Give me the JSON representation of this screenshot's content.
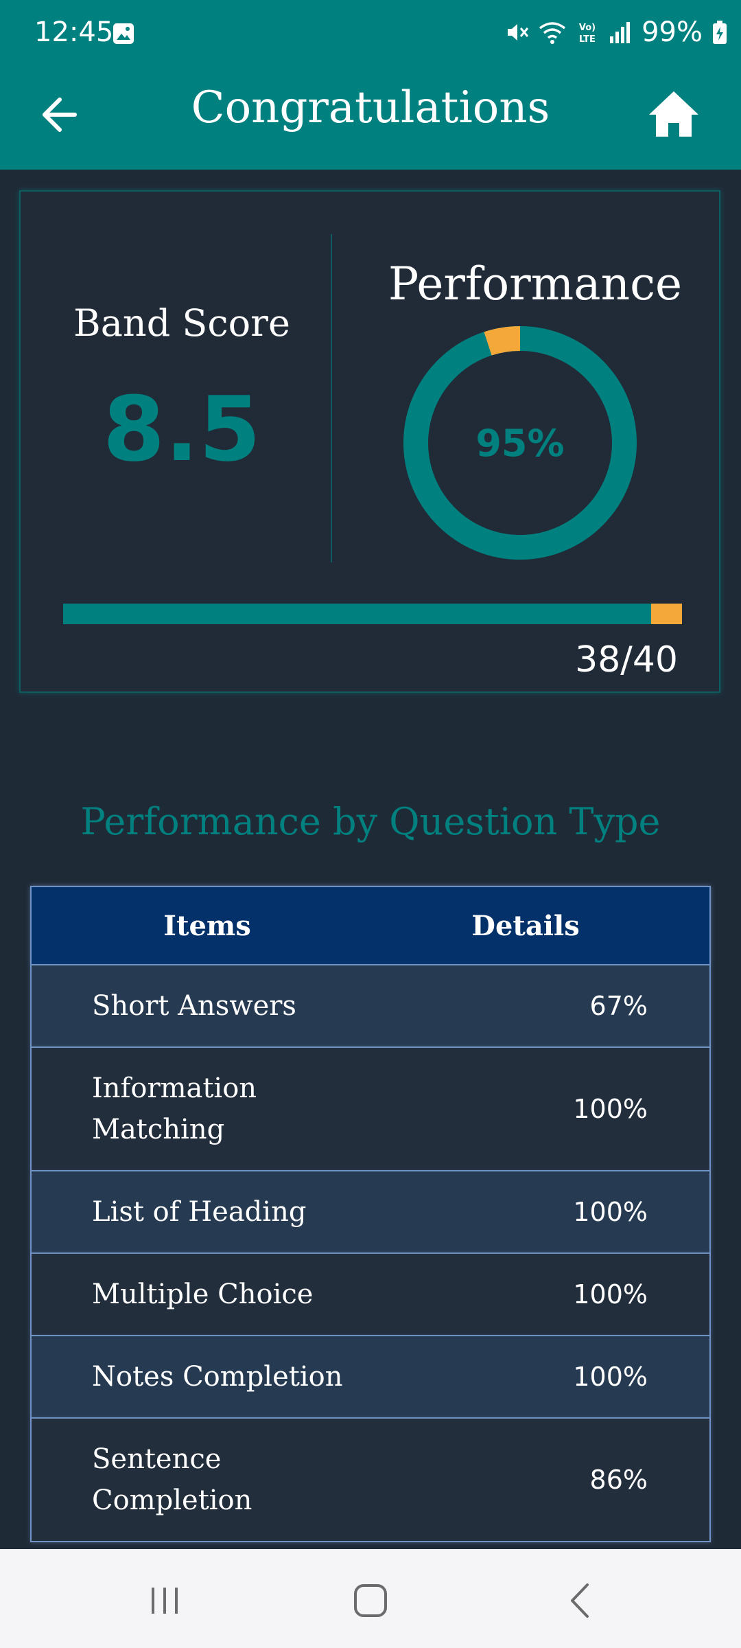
{
  "status_bar": {
    "time": "12:45",
    "battery": "99%",
    "icons": [
      "gallery-icon",
      "mute-icon",
      "wifi-icon",
      "volte-icon",
      "signal-icon",
      "battery-charging-icon"
    ]
  },
  "app_bar": {
    "title": "Congratulations",
    "back_icon": "arrow-left-icon",
    "home_icon": "home-icon"
  },
  "score_card": {
    "band_label": "Band Score",
    "band_value": "8.5",
    "performance_label": "Performance",
    "performance_percent": "95%",
    "performance_fraction": 0.95,
    "correct_count": "38/40",
    "correct_fraction": 0.95
  },
  "section_title": "Performance by Question Type",
  "table": {
    "headers": {
      "items": "Items",
      "details": "Details"
    },
    "rows": [
      {
        "item": "Short Answers",
        "detail": "67%",
        "lines": 1
      },
      {
        "item": "Information Matching",
        "detail": "100%",
        "lines": 2
      },
      {
        "item": "List of Heading",
        "detail": "100%",
        "lines": 1
      },
      {
        "item": "Multiple Choice",
        "detail": "100%",
        "lines": 1
      },
      {
        "item": "Notes Completion",
        "detail": "100%",
        "lines": 1
      },
      {
        "item": "Sentence Completion",
        "detail": "86%",
        "lines": 2
      }
    ]
  },
  "colors": {
    "primary": "#00807f",
    "accent": "#f5a83a",
    "background": "#1f2a37",
    "table_header": "#04316a"
  },
  "nav_bar": {
    "icons": [
      "recent-apps-icon",
      "home-nav-icon",
      "back-nav-icon"
    ]
  }
}
